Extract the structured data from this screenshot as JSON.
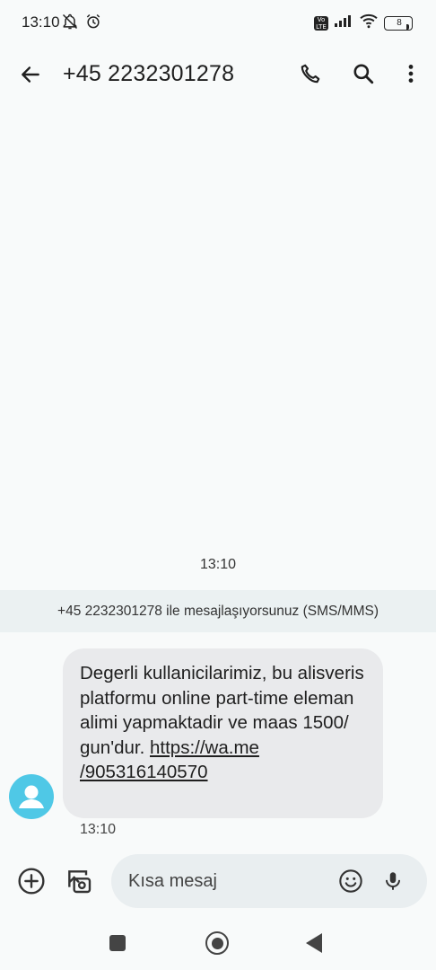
{
  "status_bar": {
    "time": "13:10",
    "icons": [
      "bell-off-icon",
      "alarm-icon",
      "volte-icon",
      "signal-icon",
      "wifi-icon",
      "battery-icon"
    ],
    "volte_label_top": "Vo",
    "volte_label_bottom": "LTE",
    "battery_level": "8",
    "battery_color": "#f5c518"
  },
  "header": {
    "title": "+45 2232301278",
    "icons": [
      "back-arrow-icon",
      "phone-icon",
      "search-icon",
      "more-vert-icon"
    ]
  },
  "conversation": {
    "date_separator": "13:10",
    "info_banner": "+45 2232301278 ile mesajlaşıyorsunuz (SMS/MMS)",
    "messages": [
      {
        "text": "Degerli kullanicilarimiz, bu alisveris platformu online part-time eleman alimi yapmaktadir ve maas 1500/ gun'dur. ",
        "link": "https://wa.me /905316140570",
        "time": "13:10"
      }
    ]
  },
  "compose": {
    "placeholder": "Kısa mesaj",
    "icons": [
      "add-circle-icon",
      "gallery-icon",
      "emoji-icon",
      "mic-icon"
    ]
  },
  "navigation": {
    "icons": [
      "recents-icon",
      "home-icon",
      "back-icon"
    ]
  },
  "colors": {
    "background": "#f8fafa",
    "banner": "#ebf1f2",
    "bubble": "#e9eaec",
    "avatar": "#4fc8e6",
    "input": "#e9eef0"
  }
}
